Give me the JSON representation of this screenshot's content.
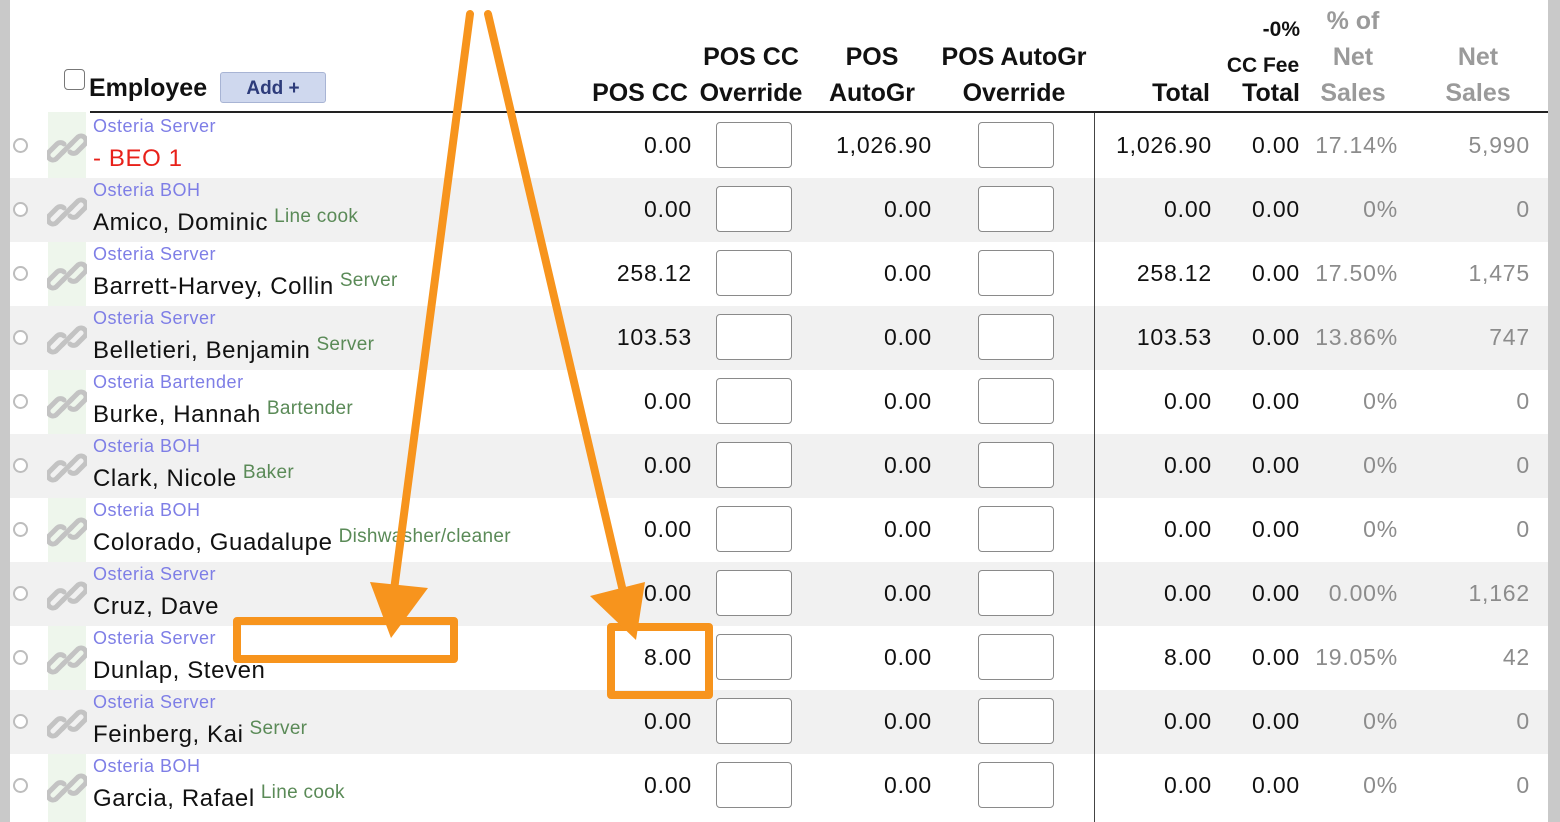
{
  "header": {
    "select_all_label": "",
    "employee": "Employee",
    "add_button": "Add +",
    "pos_cc": "POS CC",
    "pos_cc_override_1": "POS CC",
    "pos_cc_override_2": "Override",
    "pos_autogr_1": "POS",
    "pos_autogr_2": "AutoGr",
    "pos_autogr_override_1": "POS AutoGr",
    "pos_autogr_override_2": "Override",
    "total": "Total",
    "cc_fee_pct": "-0%",
    "cc_fee_1": "CC Fee",
    "cc_fee_2": "Total",
    "pct_net_1": "% of",
    "pct_net_2": "Net",
    "pct_net_3": "Sales",
    "net_sales_1": "Net",
    "net_sales_2": "Sales"
  },
  "rows": [
    {
      "dept": "Osteria Server",
      "name": "- BEO 1",
      "role": "",
      "pos_cc": "0.00",
      "pos_autogr": "1,026.90",
      "total": "1,026.90",
      "cc_fee": "0.00",
      "pct_net": "17.14%",
      "net_sales": "5,990"
    },
    {
      "dept": "Osteria BOH",
      "name": "Amico, Dominic",
      "role": "Line cook",
      "pos_cc": "0.00",
      "pos_autogr": "0.00",
      "total": "0.00",
      "cc_fee": "0.00",
      "pct_net": "0%",
      "net_sales": "0"
    },
    {
      "dept": "Osteria Server",
      "name": "Barrett-Harvey, Collin",
      "role": "Server",
      "pos_cc": "258.12",
      "pos_autogr": "0.00",
      "total": "258.12",
      "cc_fee": "0.00",
      "pct_net": "17.50%",
      "net_sales": "1,475"
    },
    {
      "dept": "Osteria Server",
      "name": "Belletieri, Benjamin",
      "role": "Server",
      "pos_cc": "103.53",
      "pos_autogr": "0.00",
      "total": "103.53",
      "cc_fee": "0.00",
      "pct_net": "13.86%",
      "net_sales": "747"
    },
    {
      "dept": "Osteria Bartender",
      "name": "Burke, Hannah",
      "role": "Bartender",
      "pos_cc": "0.00",
      "pos_autogr": "0.00",
      "total": "0.00",
      "cc_fee": "0.00",
      "pct_net": "0%",
      "net_sales": "0"
    },
    {
      "dept": "Osteria BOH",
      "name": "Clark, Nicole",
      "role": "Baker",
      "pos_cc": "0.00",
      "pos_autogr": "0.00",
      "total": "0.00",
      "cc_fee": "0.00",
      "pct_net": "0%",
      "net_sales": "0"
    },
    {
      "dept": "Osteria BOH",
      "name": "Colorado, Guadalupe",
      "role": "Dishwasher/cleaner",
      "pos_cc": "0.00",
      "pos_autogr": "0.00",
      "total": "0.00",
      "cc_fee": "0.00",
      "pct_net": "0%",
      "net_sales": "0"
    },
    {
      "dept": "Osteria Server",
      "name": "Cruz, Dave",
      "role": "",
      "pos_cc": "0.00",
      "pos_autogr": "0.00",
      "total": "0.00",
      "cc_fee": "0.00",
      "pct_net": "0.00%",
      "net_sales": "1,162"
    },
    {
      "dept": "Osteria Server",
      "name": "Dunlap, Steven",
      "role": "",
      "pos_cc": "8.00",
      "pos_autogr": "0.00",
      "total": "8.00",
      "cc_fee": "0.00",
      "pct_net": "19.05%",
      "net_sales": "42"
    },
    {
      "dept": "Osteria Server",
      "name": "Feinberg, Kai",
      "role": "Server",
      "pos_cc": "0.00",
      "pos_autogr": "0.00",
      "total": "0.00",
      "cc_fee": "0.00",
      "pct_net": "0%",
      "net_sales": "0"
    },
    {
      "dept": "Osteria BOH",
      "name": "Garcia, Rafael",
      "role": "Line cook",
      "pos_cc": "0.00",
      "pos_autogr": "0.00",
      "total": "0.00",
      "cc_fee": "0.00",
      "pct_net": "0%",
      "net_sales": "0"
    }
  ],
  "annotation": {
    "color": "#f7941d",
    "icon": "arrow-annotation"
  }
}
